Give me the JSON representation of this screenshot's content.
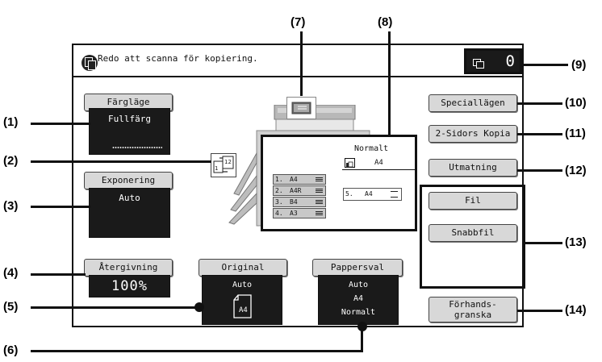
{
  "status": {
    "message": "Redo att scanna för kopiering.",
    "job_count": "0"
  },
  "left": {
    "color_mode": {
      "label": "Färgläge",
      "value": "Fullfärg"
    },
    "exposure": {
      "label": "Exponering",
      "value": "Auto"
    },
    "ratio": {
      "label": "Återgivning",
      "value": "100%"
    }
  },
  "original": {
    "label": "Original",
    "value": "Auto",
    "size": "A4"
  },
  "paper_select": {
    "label": "Pappersval",
    "size_mode": "Auto",
    "size": "A4",
    "type": "Normalt"
  },
  "paper_display": {
    "type": "Normalt",
    "selected_size": "A4",
    "trays": [
      {
        "num": "1.",
        "size": "A4"
      },
      {
        "num": "2.",
        "size": "A4R"
      },
      {
        "num": "3.",
        "size": "B4"
      },
      {
        "num": "4.",
        "size": "A3"
      }
    ],
    "bypass": {
      "num": "5.",
      "size": "A4"
    }
  },
  "right_buttons": {
    "special_modes": "Speciallägen",
    "two_sided": "2-Sidors Kopia",
    "output": "Utmatning",
    "file": "Fil",
    "quick_file": "Snabbfil",
    "preview": "Förhands-\ngranska"
  },
  "callouts": {
    "c1": "(1)",
    "c2": "(2)",
    "c3": "(3)",
    "c4": "(4)",
    "c5": "(5)",
    "c6": "(6)",
    "c7": "(7)",
    "c8": "(8)",
    "c9": "(9)",
    "c10": "(10)",
    "c11": "(11)",
    "c12": "(12)",
    "c13": "(13)",
    "c14": "(14)"
  }
}
